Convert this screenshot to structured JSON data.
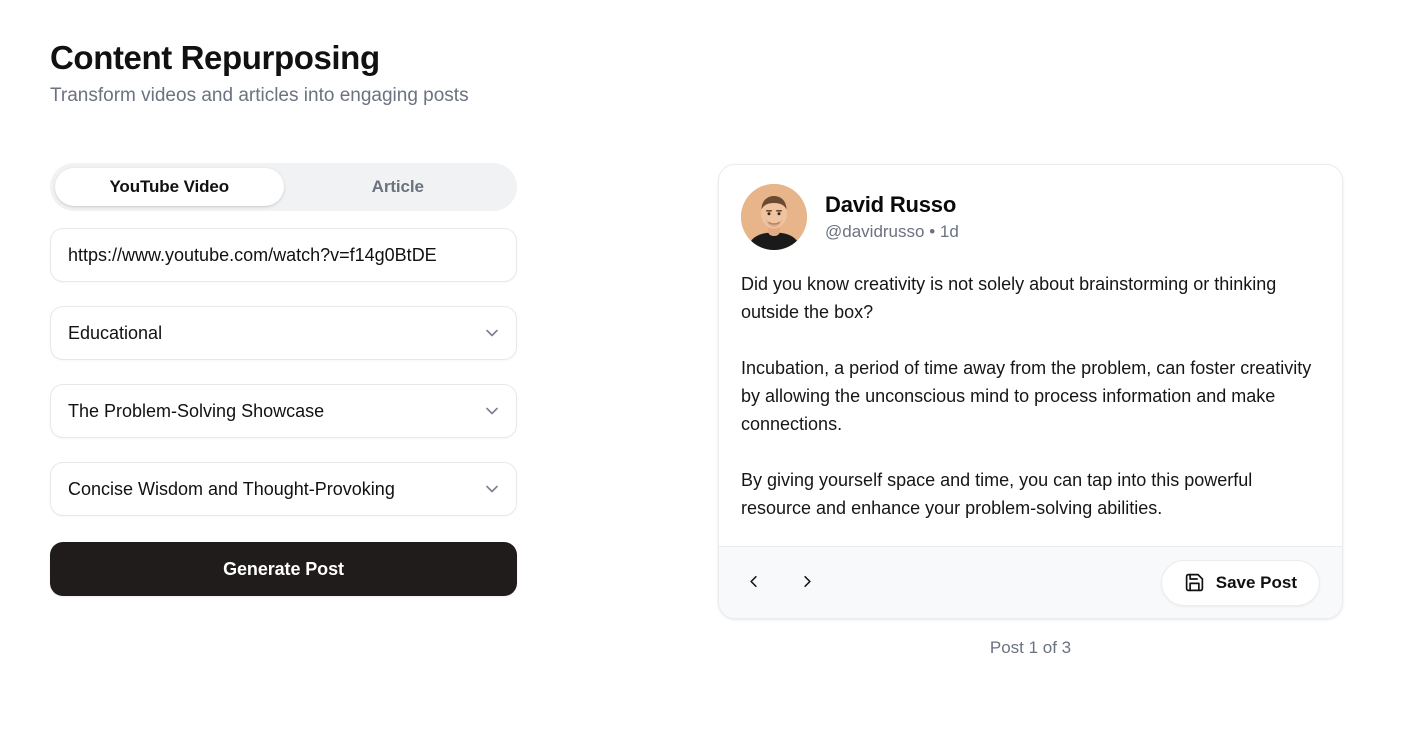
{
  "header": {
    "title": "Content Repurposing",
    "subtitle": "Transform videos and articles into engaging posts"
  },
  "form": {
    "tabs": [
      {
        "label": "YouTube Video",
        "active": true
      },
      {
        "label": "Article",
        "active": false
      }
    ],
    "url_input": {
      "value": "https://www.youtube.com/watch?v=f14g0BtDE",
      "placeholder": "Enter YouTube URL"
    },
    "selects": [
      {
        "name": "content-type",
        "value": "Educational"
      },
      {
        "name": "template",
        "value": "The Problem-Solving Showcase"
      },
      {
        "name": "tone",
        "value": "Concise Wisdom and Thought-Provoking"
      }
    ],
    "generate_button": "Generate Post"
  },
  "post": {
    "author": {
      "display_name": "David Russo",
      "handle": "@davidrusso",
      "separator": "•",
      "time": "1d",
      "meta_line": "@davidrusso • 1d"
    },
    "paragraphs": [
      "Did you know creativity is not solely about brainstorming or thinking outside the box?",
      "Incubation, a period of time away from the problem, can foster creativity by allowing the unconscious mind to process information and make connections.",
      "By giving yourself space and time, you can tap into this powerful resource and enhance your problem-solving abilities."
    ],
    "footer": {
      "prev_icon": "chevron-left-icon",
      "next_icon": "chevron-right-icon",
      "save_label": "Save Post",
      "save_icon": "floppy-disk-icon"
    },
    "counter": "Post 1 of 3"
  },
  "colors": {
    "accent_dark": "#201c1b",
    "text_primary": "#111111",
    "text_muted": "#6b7280",
    "track": "#f1f2f3",
    "card_border": "#ececee",
    "footer_bg": "#f8f9fa",
    "avatar_bg": "#e8b489"
  }
}
